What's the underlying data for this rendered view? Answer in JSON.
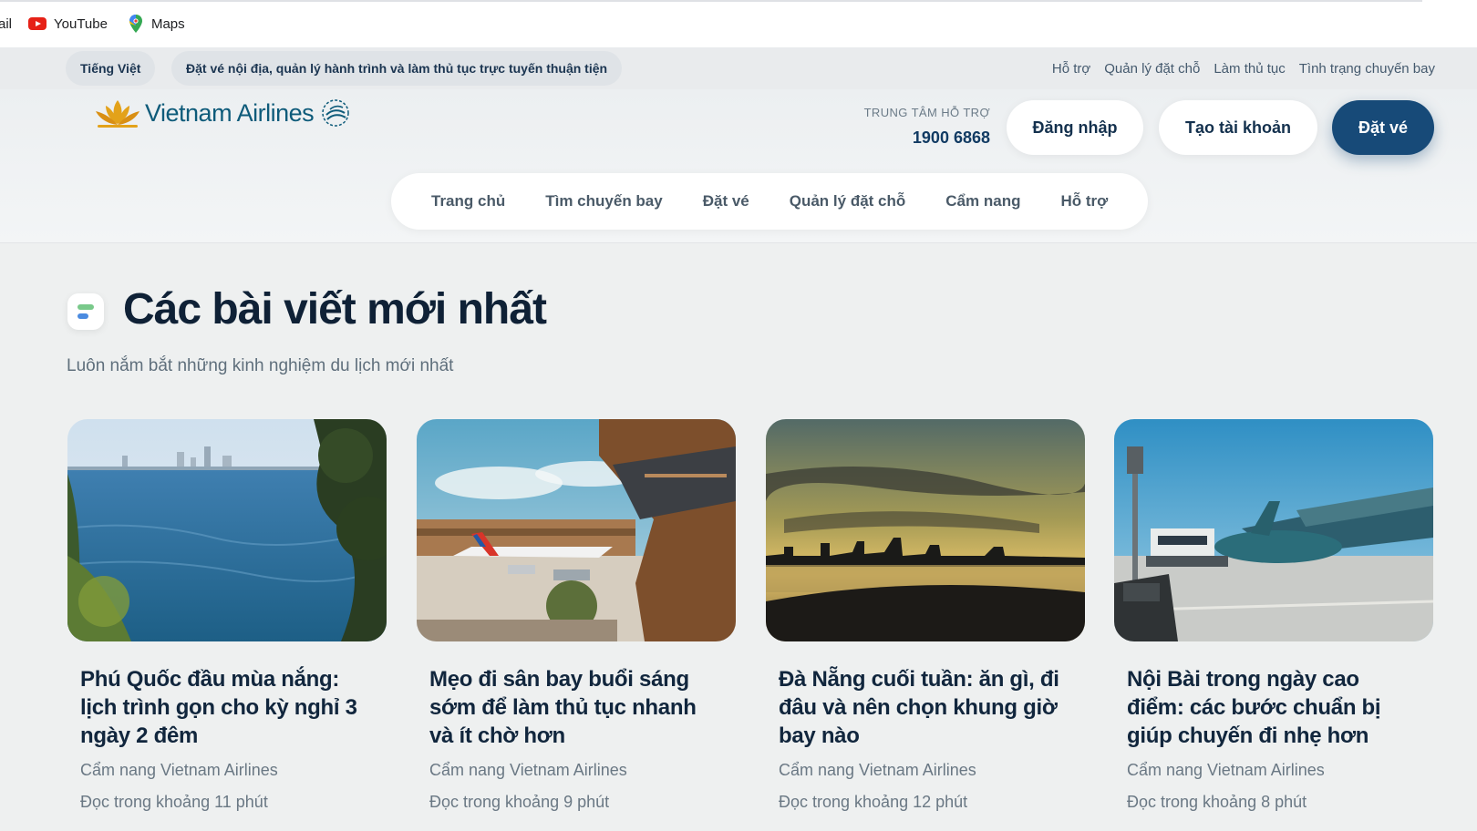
{
  "bookmarks": {
    "cut_label": "ail",
    "items": [
      {
        "label": "YouTube",
        "icon": "youtube-icon"
      },
      {
        "label": "Maps",
        "icon": "maps-pin-icon"
      }
    ]
  },
  "utility": {
    "language": "Tiếng Việt",
    "tagline": "Đặt vé nội địa, quản lý hành trình và làm thủ tục trực tuyến thuận tiện",
    "links": [
      "Hỗ trợ",
      "Quản lý đặt chỗ",
      "Làm thủ tục",
      "Tình trạng chuyến bay"
    ]
  },
  "header": {
    "logo_text": "Vietnam Airlines",
    "support_label": "TRUNG TÂM HỖ TRỢ",
    "support_phone": "1900 6868",
    "login_label": "Đăng nhập",
    "create_account_label": "Tạo tài khoản",
    "book_label": "Đặt vé"
  },
  "nav": [
    "Trang chủ",
    "Tìm chuyến bay",
    "Đặt vé",
    "Quản lý đặt chỗ",
    "Cẩm nang",
    "Hỗ trợ"
  ],
  "section": {
    "title": "Các bài viết mới nhất",
    "subtitle": "Luôn nắm bắt những kinh nghiệm du lịch mới nhất"
  },
  "articles": [
    {
      "title": "Phú Quốc đầu mùa nắng: lịch trình gọn cho kỳ nghỉ 3 ngày 2 đêm",
      "source": "Cẩm nang Vietnam Airlines",
      "read": "Đọc trong khoảng 11 phút"
    },
    {
      "title": "Mẹo đi sân bay buổi sáng sớm để làm thủ tục nhanh và ít chờ hơn",
      "source": "Cẩm nang Vietnam Airlines",
      "read": "Đọc trong khoảng 9 phút"
    },
    {
      "title": "Đà Nẵng cuối tuần: ăn gì, đi đâu và nên chọn khung giờ bay nào",
      "source": "Cẩm nang Vietnam Airlines",
      "read": "Đọc trong khoảng 12 phút"
    },
    {
      "title": "Nội Bài trong ngày cao điểm: các bước chuẩn bị giúp chuyến đi nhẹ hơn",
      "source": "Cẩm nang Vietnam Airlines",
      "read": "Đọc trong khoảng 8 phút"
    }
  ],
  "colors": {
    "brand_navy": "#174a78",
    "brand_gold": "#e3a21a",
    "logo_teal": "#0e5b7a"
  }
}
